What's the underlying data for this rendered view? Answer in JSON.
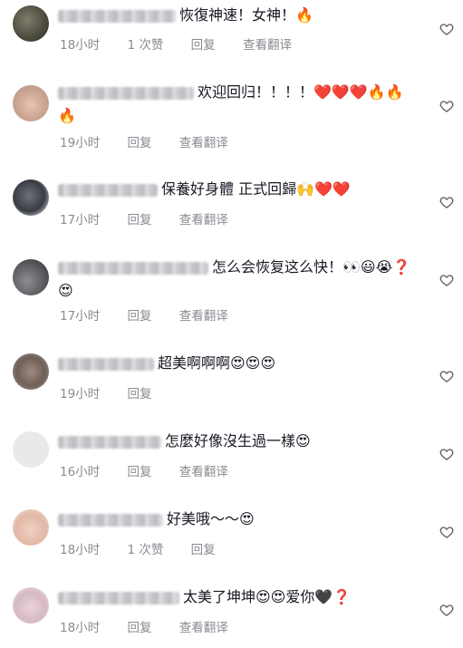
{
  "comments": [
    {
      "text": "恢復神速！女神！🔥",
      "time": "18小时",
      "likes": "1 次赞",
      "reply": "回复",
      "translate": "查看翻译"
    },
    {
      "text": "欢迎回归！！！！❤️❤️❤️🔥🔥🔥",
      "time": "19小时",
      "likes": "",
      "reply": "回复",
      "translate": "查看翻译"
    },
    {
      "text": "保養好身體 正式回歸🙌❤️❤️",
      "time": "17小时",
      "likes": "",
      "reply": "回复",
      "translate": "查看翻译"
    },
    {
      "text": "怎么会恢复这么快！👀😃😭❓😍",
      "time": "17小时",
      "likes": "",
      "reply": "回复",
      "translate": "查看翻译"
    },
    {
      "text": "超美啊啊啊😍😍😍",
      "time": "19小时",
      "likes": "",
      "reply": "回复",
      "translate": ""
    },
    {
      "text": "怎麼好像沒生過一樣😍",
      "time": "16小时",
      "likes": "",
      "reply": "回复",
      "translate": "查看翻译"
    },
    {
      "text": "好美哦～～😍",
      "time": "18小时",
      "likes": "1 次赞",
      "reply": "回复",
      "translate": ""
    },
    {
      "text": "太美了坤坤😍😍爱你🖤❓",
      "time": "18小时",
      "likes": "",
      "reply": "回复",
      "translate": "查看翻译"
    }
  ],
  "icons": {
    "like": "heart-outline-icon",
    "avatar": "avatar"
  },
  "colors": {
    "meta": "#8a8b91",
    "text": "#161823"
  }
}
